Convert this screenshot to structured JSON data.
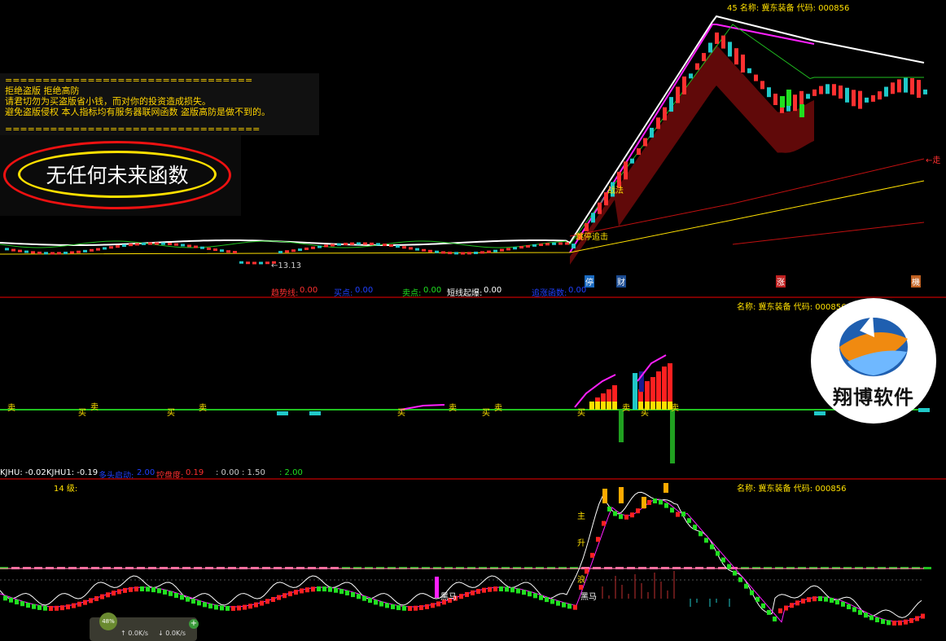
{
  "colors": {
    "bg": "#000000",
    "red": "#ff2020",
    "green": "#20e020",
    "cyan": "#20c8c8",
    "yellow": "#ffe000",
    "magenta": "#ff20ff",
    "white": "#ffffff",
    "darkred": "#7a0000"
  },
  "panel1": {
    "header": "45 名称: 冀东装备 代码: 000856",
    "notice": {
      "rule": "=================================",
      "line1": "拒绝盗版  拒绝高防",
      "line2": "请君切勿为买盗版省小钱，而对你的投资造成损失。",
      "line3": "避免盗版侵权   本人指标均有服务器联网函数  盗版高防是做不到的。",
      "rule2": "=================================="
    },
    "badge": "无任何未来函数",
    "low_label": "←13.13",
    "tag_zhanfa": "战法",
    "tag_tiaojie": "跳停追击",
    "tag_right": "←走",
    "markers": {
      "m1": "停",
      "m2": "财",
      "m3": "涨",
      "m4": "機"
    },
    "strip": {
      "a_label": "趋势线:",
      "a_val": "0.00",
      "b_label": "买点:",
      "b_val": "0.00",
      "c_label": "卖点:",
      "c_val": "0.00",
      "d_label": "短线起爆:",
      "d_val": "0.00",
      "e_label": "追涨函数:",
      "e_val": "0.00"
    }
  },
  "panel2": {
    "header": "名称: 冀东装备 代码: 000856",
    "sell": "卖",
    "buy": "买",
    "strip": {
      "a": "KJHU: -0.02",
      "b": "KJHU1: -0.19",
      "c_label": "多头启动:",
      "c_val": "2.00",
      "d_label": "控盘度:",
      "d_val": "0.19",
      "e": ": 0.00 : 1.50",
      "f": ": 2.00"
    }
  },
  "panel3": {
    "header": "名称: 冀东装备 代码: 000856",
    "level": "14  级:",
    "zhu": "主",
    "sheng": "升",
    "lang": "浪",
    "heima1": "黑马",
    "heima2": "黑马"
  },
  "logo": {
    "text": "翔博软件"
  },
  "widget": {
    "pct": "48%",
    "up": "↑ 0.0K/s",
    "down": "↓ 0.0K/s"
  }
}
